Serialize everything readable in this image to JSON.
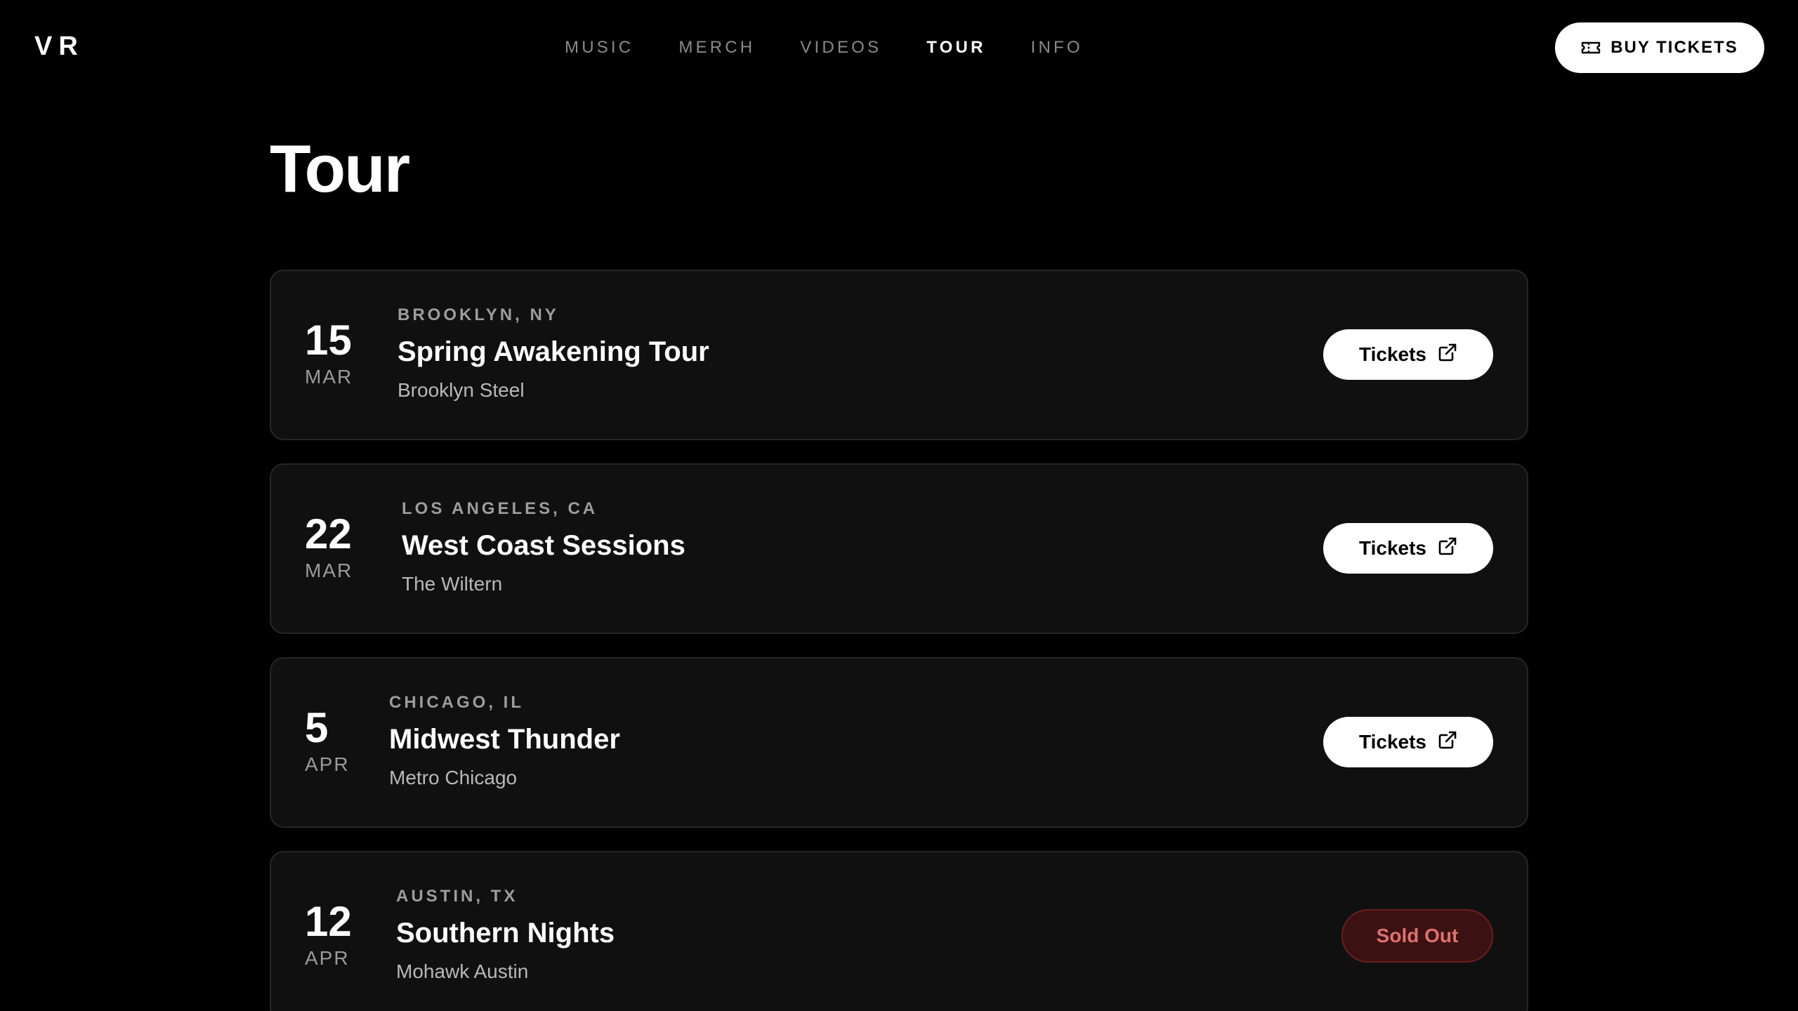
{
  "header": {
    "logo": "VR",
    "nav": [
      {
        "label": "MUSIC",
        "active": false
      },
      {
        "label": "MERCH",
        "active": false
      },
      {
        "label": "VIDEOS",
        "active": false
      },
      {
        "label": "TOUR",
        "active": true
      },
      {
        "label": "INFO",
        "active": false
      }
    ],
    "buy_button": {
      "label": "BUY TICKETS",
      "icon": "ticket-icon"
    }
  },
  "main": {
    "title": "Tour",
    "events": [
      {
        "day": "15",
        "month": "MAR",
        "city": "BROOKLYN, NY",
        "name": "Spring Awakening Tour",
        "venue": "Brooklyn Steel",
        "action": "Tickets",
        "action_icon": "external-link-icon",
        "status": "available"
      },
      {
        "day": "22",
        "month": "MAR",
        "city": "LOS ANGELES, CA",
        "name": "West Coast Sessions",
        "venue": "The Wiltern",
        "action": "Tickets",
        "action_icon": "external-link-icon",
        "status": "available"
      },
      {
        "day": "5",
        "month": "APR",
        "city": "CHICAGO, IL",
        "name": "Midwest Thunder",
        "venue": "Metro Chicago",
        "action": "Tickets",
        "action_icon": "external-link-icon",
        "status": "available"
      },
      {
        "day": "12",
        "month": "APR",
        "city": "AUSTIN, TX",
        "name": "Southern Nights",
        "venue": "Mohawk Austin",
        "action": "Sold Out",
        "status": "sold-out"
      }
    ]
  },
  "colors": {
    "background": "#000000",
    "card": "#101010",
    "card_border": "#262626",
    "sold_out_bg": "#3b1111",
    "sold_out_text": "#e07070"
  }
}
